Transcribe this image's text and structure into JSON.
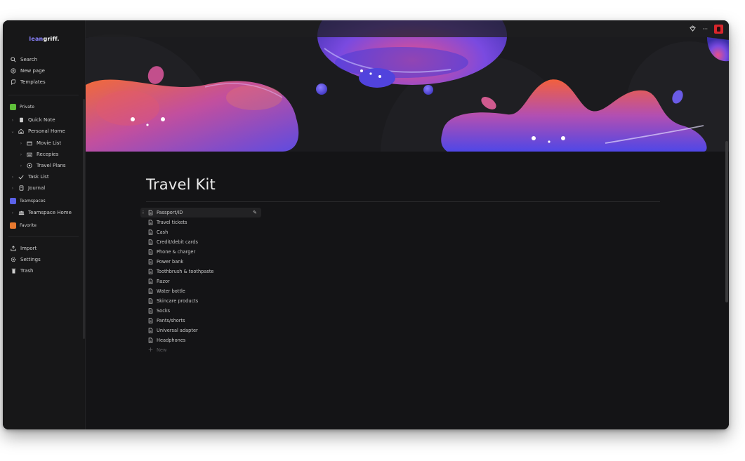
{
  "sidebar": {
    "brand_prefix": "lean",
    "brand_suffix": "griff.",
    "top_actions": [
      {
        "label": "Search",
        "icon": "search-icon"
      },
      {
        "label": "New page",
        "icon": "plus-circle-icon"
      },
      {
        "label": "Templates",
        "icon": "templates-icon"
      }
    ],
    "sections": {
      "private": {
        "label": "Private",
        "color": "#5fbf3a"
      },
      "teamspaces": {
        "label": "Teamspaces",
        "color": "#5b62e8"
      },
      "favorite": {
        "label": "Favorite",
        "color": "#e8792f"
      }
    },
    "pages": {
      "quick_note": "Quick Note",
      "personal_home": "Personal Home",
      "movie_list": "Movie List",
      "recepies": "Recepies",
      "travel_plans": "Travel Plans",
      "task_list": "Task List",
      "journal": "Journal",
      "teamspace_home": "Teamspace Home"
    },
    "bottom_actions": [
      {
        "label": "Import",
        "icon": "import-icon"
      },
      {
        "label": "Settings",
        "icon": "gear-icon"
      },
      {
        "label": "Trash",
        "icon": "trash-icon"
      }
    ]
  },
  "topbar": {
    "more": "···"
  },
  "page": {
    "title": "Travel Kit",
    "items": [
      "Passport/ID",
      "Travel tickets",
      "Cash",
      "Credit/debit cards",
      "Phone & charger",
      "Power bank",
      "Toothbrush & toothpaste",
      "Razor",
      "Water bottle",
      "Skincare products",
      "Socks",
      "Pants/shorts",
      "Universal adapter",
      "Headphones"
    ],
    "new_label": "New"
  },
  "colors": {
    "background": "#141416",
    "sidebar": "#171718",
    "accent": "#8b83ff",
    "cover_purple": "#5e4be0",
    "cover_pink": "#e05a9a",
    "cover_orange": "#f06a3a"
  }
}
